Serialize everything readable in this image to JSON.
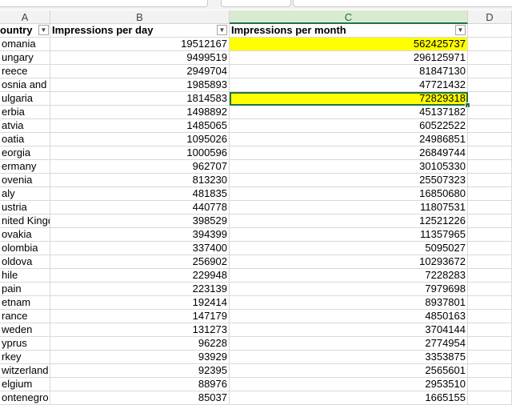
{
  "columns": [
    {
      "letter": "A"
    },
    {
      "letter": "B"
    },
    {
      "letter": "C"
    },
    {
      "letter": "D"
    }
  ],
  "header": {
    "a": "ountry",
    "b": "Impressions per day",
    "c": "Impressions per month"
  },
  "filter_icon": "dropdown-arrow-icon",
  "highlight_color": "#ffff00",
  "active_border_color": "#217346",
  "rows": [
    {
      "country": "omania",
      "day": "19512167",
      "month": "562425737"
    },
    {
      "country": "ungary",
      "day": "9499519",
      "month": "296125971"
    },
    {
      "country": "reece",
      "day": "2949704",
      "month": "81847130"
    },
    {
      "country": "osnia and H",
      "day": "1985893",
      "month": "47721432"
    },
    {
      "country": "ulgaria",
      "day": "1814583",
      "month": "72829318"
    },
    {
      "country": "erbia",
      "day": "1498892",
      "month": "45137182"
    },
    {
      "country": "atvia",
      "day": "1485065",
      "month": "60522522"
    },
    {
      "country": "oatia",
      "day": "1095026",
      "month": "24986851"
    },
    {
      "country": "eorgia",
      "day": "1000596",
      "month": "26849744"
    },
    {
      "country": "ermany",
      "day": "962707",
      "month": "30105330"
    },
    {
      "country": "ovenia",
      "day": "813230",
      "month": "25507323"
    },
    {
      "country": "aly",
      "day": "481835",
      "month": "16850680"
    },
    {
      "country": "ustria",
      "day": "440778",
      "month": "11807531"
    },
    {
      "country": "nited Kingdo",
      "day": "398529",
      "month": "12521226"
    },
    {
      "country": "ovakia",
      "day": "394399",
      "month": "11357965"
    },
    {
      "country": "olombia",
      "day": "337400",
      "month": "5095027"
    },
    {
      "country": "oldova",
      "day": "256902",
      "month": "10293672"
    },
    {
      "country": "hile",
      "day": "229948",
      "month": "7228283"
    },
    {
      "country": "pain",
      "day": "223139",
      "month": "7979698"
    },
    {
      "country": "etnam",
      "day": "192414",
      "month": "8937801"
    },
    {
      "country": "rance",
      "day": "147179",
      "month": "4850163"
    },
    {
      "country": "weden",
      "day": "131273",
      "month": "3704144"
    },
    {
      "country": "yprus",
      "day": "96228",
      "month": "2774954"
    },
    {
      "country": "rkey",
      "day": "93929",
      "month": "3353875"
    },
    {
      "country": "witzerland",
      "day": "92395",
      "month": "2565601"
    },
    {
      "country": "elgium",
      "day": "88976",
      "month": "2953510"
    },
    {
      "country": "ontenegro",
      "day": "85037",
      "month": "1665155"
    }
  ],
  "highlighted_rows": [
    0,
    4
  ],
  "active_row": 4
}
